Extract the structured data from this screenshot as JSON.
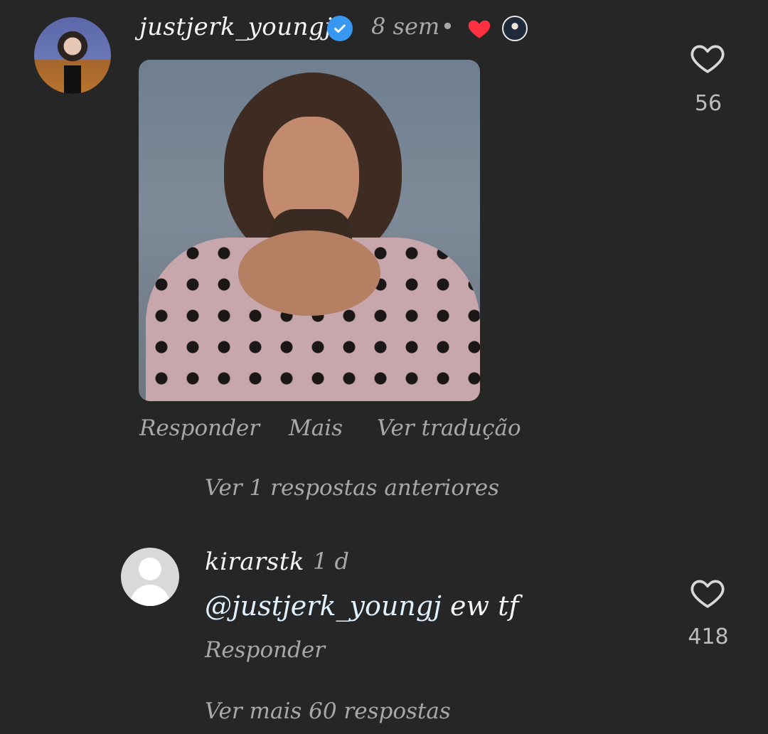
{
  "comment_main": {
    "username": "justjerk_youngj",
    "time": "8 sem",
    "dot": "•",
    "actions": {
      "reply": "Responder",
      "more": "Mais",
      "translate": "Ver tradução"
    },
    "likes": "56"
  },
  "previous_replies": "Ver 1 respostas anteriores",
  "reply": {
    "username": "kirarstk",
    "time": "1 d",
    "mention": "@justjerk_youngj",
    "text": " ew tf",
    "action_reply": "Responder",
    "likes": "418"
  },
  "more_replies": "Ver mais 60 respostas",
  "colors": {
    "background": "#262626",
    "verified": "#3897f0",
    "heart": "#ff3040",
    "muted": "#a8a8a8"
  },
  "icons": [
    "verified-badge-icon",
    "red-heart-reaction-icon",
    "like-heart-icon"
  ]
}
